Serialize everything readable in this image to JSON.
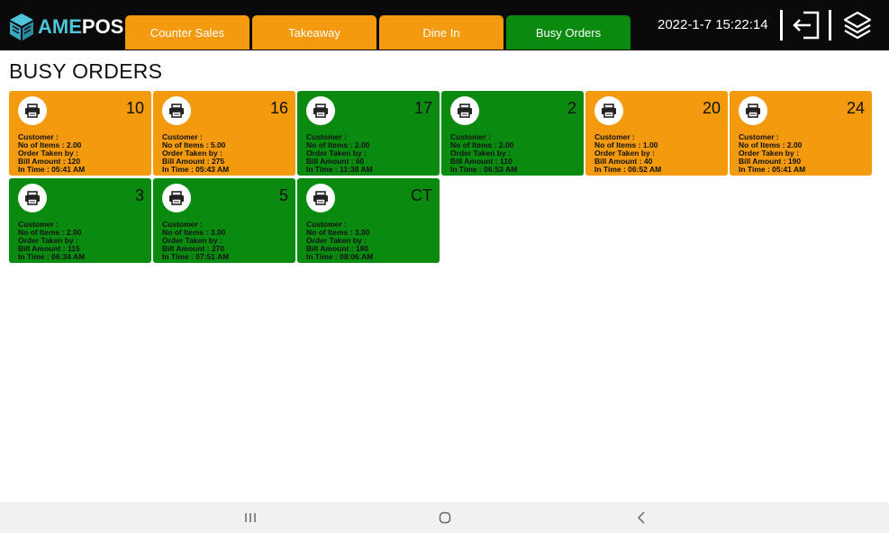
{
  "app": {
    "logo_ame": "AME",
    "logo_pos": "POS"
  },
  "tabs": [
    {
      "label": "Counter Sales",
      "color": "#f39a0e"
    },
    {
      "label": "Takeaway",
      "color": "#f39a0e"
    },
    {
      "label": "Dine In",
      "color": "#f39a0e"
    },
    {
      "label": "Busy Orders",
      "color": "#0b8a10"
    }
  ],
  "header": {
    "datetime": "2022-1-7 15:22:14",
    "logout_icon": "logout-icon",
    "layers_icon": "layers-icon"
  },
  "page": {
    "title": "BUSY ORDERS"
  },
  "field_labels": {
    "customer": "Customer :",
    "items": "No of Items :",
    "taken_by": "Order Taken by :",
    "bill": "Bill Amount :",
    "time": "In Time :"
  },
  "colors": {
    "orange": "#f39a0e",
    "green": "#0b8a10"
  },
  "orders": [
    {
      "table": "10",
      "status": "orange",
      "customer": "",
      "items": "2.00",
      "taken_by": "",
      "bill": "120",
      "time": "05:41 AM"
    },
    {
      "table": "16",
      "status": "orange",
      "customer": "",
      "items": "5.00",
      "taken_by": "",
      "bill": "275",
      "time": "05:43 AM"
    },
    {
      "table": "17",
      "status": "green",
      "customer": "",
      "items": "2.00",
      "taken_by": "",
      "bill": "60",
      "time": "11:38 AM"
    },
    {
      "table": "2",
      "status": "green",
      "customer": "",
      "items": "2.00",
      "taken_by": "",
      "bill": "110",
      "time": "06:53 AM"
    },
    {
      "table": "20",
      "status": "orange",
      "customer": "",
      "items": "1.00",
      "taken_by": "",
      "bill": "40",
      "time": "06:52 AM"
    },
    {
      "table": "24",
      "status": "orange",
      "customer": "",
      "items": "2.00",
      "taken_by": "",
      "bill": "190",
      "time": "05:41 AM"
    },
    {
      "table": "3",
      "status": "green",
      "customer": "",
      "items": "2.00",
      "taken_by": "",
      "bill": "115",
      "time": "06:34 AM"
    },
    {
      "table": "5",
      "status": "green",
      "customer": "",
      "items": "3.00",
      "taken_by": "",
      "bill": "270",
      "time": "07:51 AM"
    },
    {
      "table": "CT",
      "status": "green",
      "customer": "",
      "items": "3.00",
      "taken_by": "",
      "bill": "180",
      "time": "08:06 AM"
    }
  ],
  "navbar": {
    "recent_icon": "recent-apps-icon",
    "home_icon": "home-icon",
    "back_icon": "back-icon"
  }
}
